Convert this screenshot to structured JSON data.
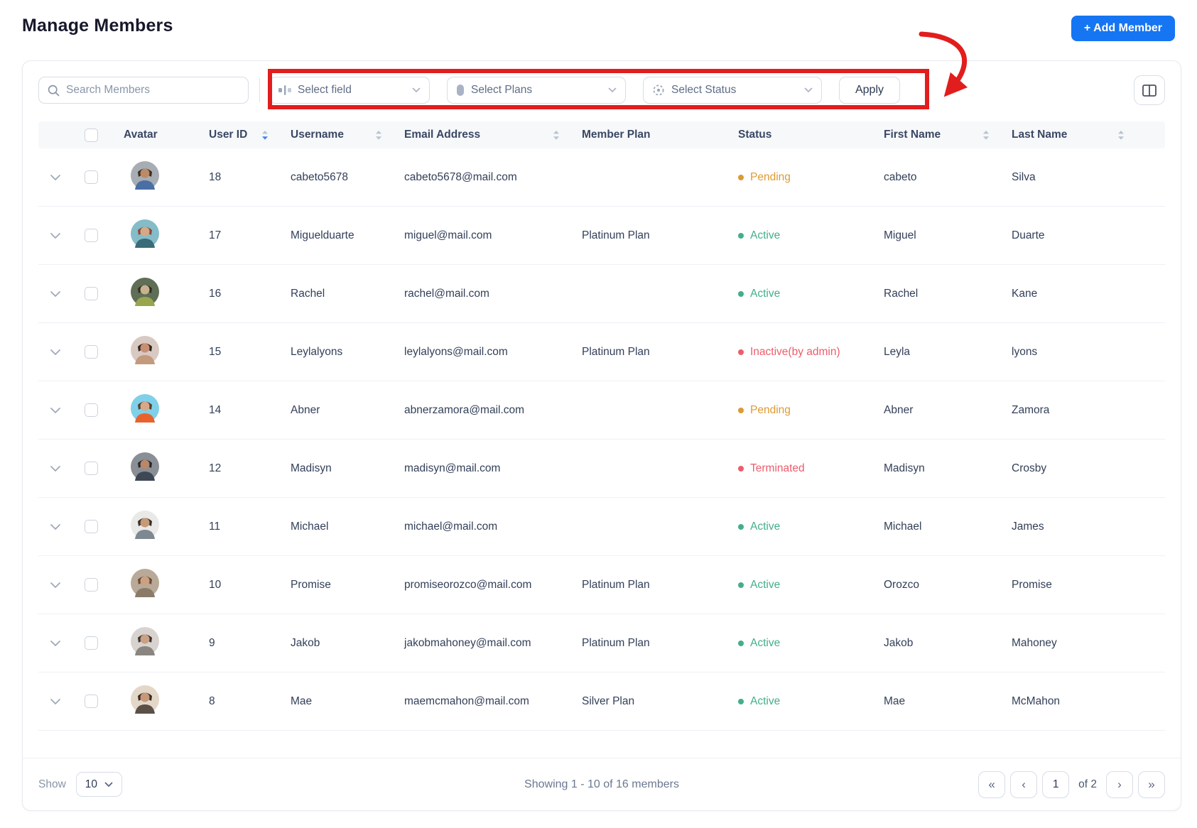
{
  "page": {
    "title": "Manage Members"
  },
  "header": {
    "add_member_label": "+ Add Member"
  },
  "filters": {
    "search_placeholder": "Search Members",
    "select_field_label": "Select field",
    "select_plans_label": "Select Plans",
    "select_status_label": "Select Status",
    "apply_label": "Apply"
  },
  "table": {
    "columns": [
      "Avatar",
      "User ID",
      "Username",
      "Email Address",
      "Member Plan",
      "Status",
      "First Name",
      "Last Name"
    ],
    "sort": {
      "column": "User ID",
      "direction": "desc"
    },
    "rows": [
      {
        "user_id": "18",
        "username": "cabeto5678",
        "email": "cabeto5678@mail.com",
        "plan": "",
        "status": "Pending",
        "status_type": "pending",
        "first_name": "cabeto",
        "last_name": "Silva",
        "avatar": {
          "bg": "#a7adb3",
          "skin": "#bd8a66",
          "hair": "#3a2d24",
          "shirt": "#4a6fa5"
        }
      },
      {
        "user_id": "17",
        "username": "Miguelduarte",
        "email": "miguel@mail.com",
        "plan": "Platinum Plan",
        "status": "Active",
        "status_type": "active",
        "first_name": "Miguel",
        "last_name": "Duarte",
        "avatar": {
          "bg": "#84bcc9",
          "skin": "#d7a887",
          "hair": "#8c4a38",
          "shirt": "#3a6b78"
        }
      },
      {
        "user_id": "16",
        "username": "Rachel",
        "email": "rachel@mail.com",
        "plan": "",
        "status": "Active",
        "status_type": "active",
        "first_name": "Rachel",
        "last_name": "Kane",
        "avatar": {
          "bg": "#5f6e55",
          "skin": "#c9b18f",
          "hair": "#2c2f26",
          "shirt": "#99a64e"
        }
      },
      {
        "user_id": "15",
        "username": "Leylalyons",
        "email": "leylalyons@mail.com",
        "plan": "Platinum Plan",
        "status": "Inactive(by admin)",
        "status_type": "inactive",
        "first_name": "Leyla",
        "last_name": "lyons",
        "avatar": {
          "bg": "#d8c9c2",
          "skin": "#c98f72",
          "hair": "#2e2420",
          "shirt": "#c49a7d"
        }
      },
      {
        "user_id": "14",
        "username": "Abner",
        "email": "abnerzamora@mail.com",
        "plan": "",
        "status": "Pending",
        "status_type": "pending",
        "first_name": "Abner",
        "last_name": "Zamora",
        "avatar": {
          "bg": "#7fd0e8",
          "skin": "#d8a888",
          "hair": "#5a3d2e",
          "shirt": "#e8622d"
        }
      },
      {
        "user_id": "12",
        "username": "Madisyn",
        "email": "madisyn@mail.com",
        "plan": "",
        "status": "Terminated",
        "status_type": "terminated",
        "first_name": "Madisyn",
        "last_name": "Crosby",
        "avatar": {
          "bg": "#8a8f96",
          "skin": "#b9876a",
          "hair": "#23262b",
          "shirt": "#3d4854"
        }
      },
      {
        "user_id": "11",
        "username": "Michael",
        "email": "michael@mail.com",
        "plan": "",
        "status": "Active",
        "status_type": "active",
        "first_name": "Michael",
        "last_name": "James",
        "avatar": {
          "bg": "#e9e9e7",
          "skin": "#c59a78",
          "hair": "#3a2f28",
          "shirt": "#7e8890"
        }
      },
      {
        "user_id": "10",
        "username": "Promise",
        "email": "promiseorozco@mail.com",
        "plan": "Platinum Plan",
        "status": "Active",
        "status_type": "active",
        "first_name": "Orozco",
        "last_name": "Promise",
        "avatar": {
          "bg": "#b9a998",
          "skin": "#caa183",
          "hair": "#6b4a33",
          "shirt": "#8c7a68"
        }
      },
      {
        "user_id": "9",
        "username": "Jakob",
        "email": "jakobmahoney@mail.com",
        "plan": "Platinum Plan",
        "status": "Active",
        "status_type": "active",
        "first_name": "Jakob",
        "last_name": "Mahoney",
        "avatar": {
          "bg": "#d8d3cf",
          "skin": "#c9a184",
          "hair": "#3d3330",
          "shirt": "#8a8580"
        }
      },
      {
        "user_id": "8",
        "username": "Mae",
        "email": "maemcmahon@mail.com",
        "plan": "Silver Plan",
        "status": "Active",
        "status_type": "active",
        "first_name": "Mae",
        "last_name": "McMahon",
        "avatar": {
          "bg": "#e3d7c8",
          "skin": "#c59a78",
          "hair": "#3a2b26",
          "shirt": "#5a5048"
        }
      }
    ]
  },
  "footer": {
    "show_label": "Show",
    "page_size": "10",
    "summary": "Showing 1 - 10 of 16 members",
    "pagination": {
      "first": "«",
      "prev": "‹",
      "current_page": "1",
      "of_label": "of 2",
      "next": "›",
      "last": "»"
    }
  },
  "colors": {
    "accent_blue": "#1675f2",
    "sort_active_blue": "#3b82f6",
    "annotation_red": "#e21d1d",
    "status": {
      "pending": "#dd9a33",
      "active": "#43ae8b",
      "inactive": "#ee5c6c",
      "terminated": "#ee5c6c"
    }
  }
}
